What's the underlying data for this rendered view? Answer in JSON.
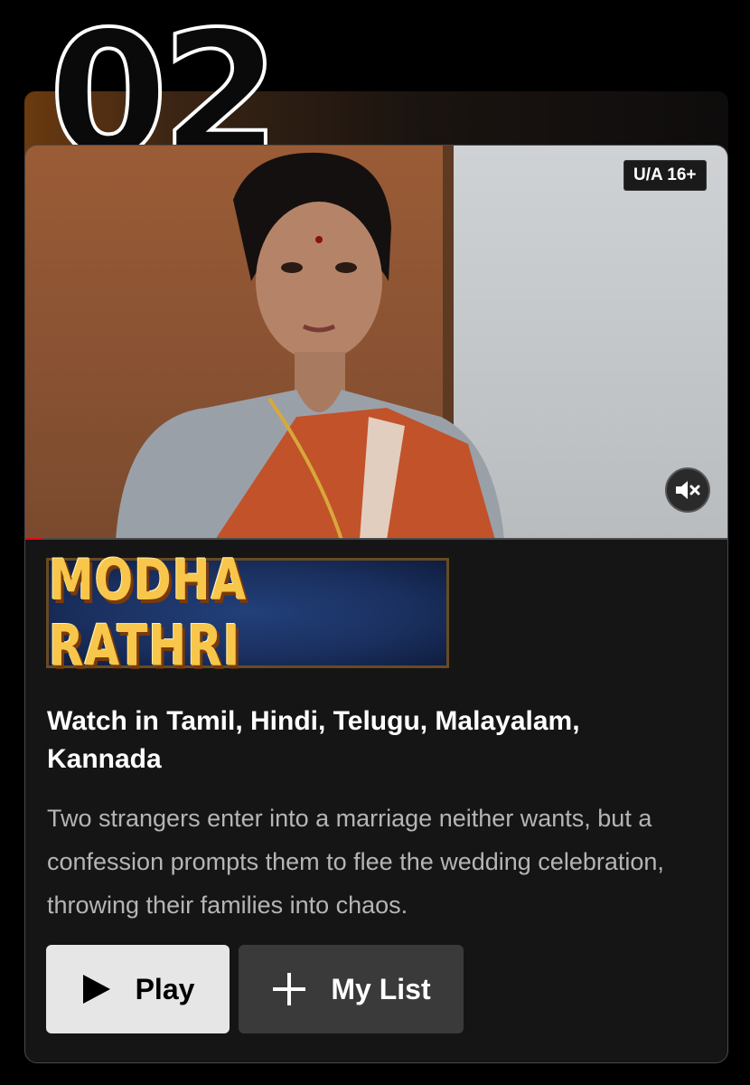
{
  "rank": "02",
  "media": {
    "rating": "U/A 16+",
    "progress_fraction": 0.025,
    "mute_icon": "volume-muted-icon"
  },
  "title_logo": "MODHA RATHRI",
  "subtitle": "Watch in Tamil, Hindi, Telugu, Malayalam, Kannada",
  "description": "Two strangers enter into a marriage neither wants, but a confession prompts them to flee the wedding celebration, throwing their families into chaos.",
  "buttons": {
    "play": {
      "label": "Play",
      "icon": "play-icon"
    },
    "my_list": {
      "label": "My List",
      "icon": "plus-icon"
    }
  },
  "colors": {
    "accent": "#e50914",
    "logo_text": "#f7c64a"
  }
}
